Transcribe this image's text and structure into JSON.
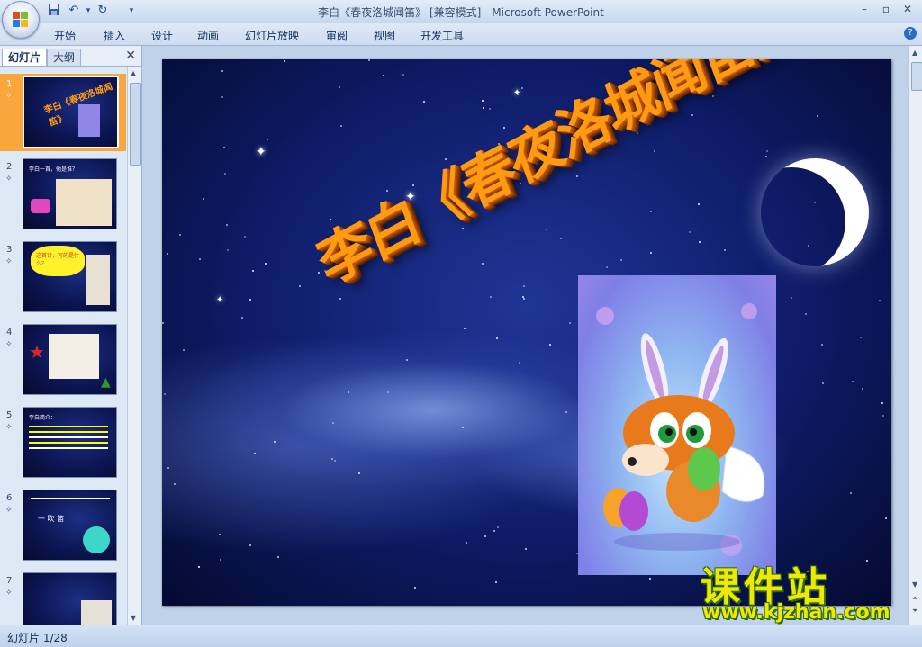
{
  "app": {
    "window_title": "李白《春夜洛城闻笛》 [兼容模式] - Microsoft PowerPoint",
    "window_controls": [
      "minimize-icon",
      "maximize-icon",
      "close-icon"
    ]
  },
  "quick_access": [
    "save-icon",
    "undo-icon",
    "redo-icon",
    "customize-icon"
  ],
  "ribbon": {
    "tabs": [
      "开始",
      "插入",
      "设计",
      "动画",
      "幻灯片放映",
      "审阅",
      "视图",
      "开发工具"
    ]
  },
  "left_pane": {
    "tabs": [
      "幻灯片",
      "大纲"
    ],
    "thumbnails": [
      {
        "number": "1",
        "selected": true
      },
      {
        "number": "2",
        "text": "李白一首，他是谁？"
      },
      {
        "number": "3",
        "text": "这首诗，写的是什么？"
      },
      {
        "number": "4"
      },
      {
        "number": "5",
        "text": "李白简介："
      },
      {
        "number": "6",
        "text": "一 吹 笛"
      },
      {
        "number": "7"
      }
    ]
  },
  "slide": {
    "title": "李白《春夜洛城闻笛》"
  },
  "status": {
    "slide_indicator": "幻灯片 1/28"
  },
  "watermark": {
    "name": "课件站",
    "url": "www.kjzhan.com"
  },
  "colors": {
    "accent_orange": "#f9a63d",
    "title_orange": "#ff9a12",
    "watermark_yellow": "#f0e800"
  }
}
